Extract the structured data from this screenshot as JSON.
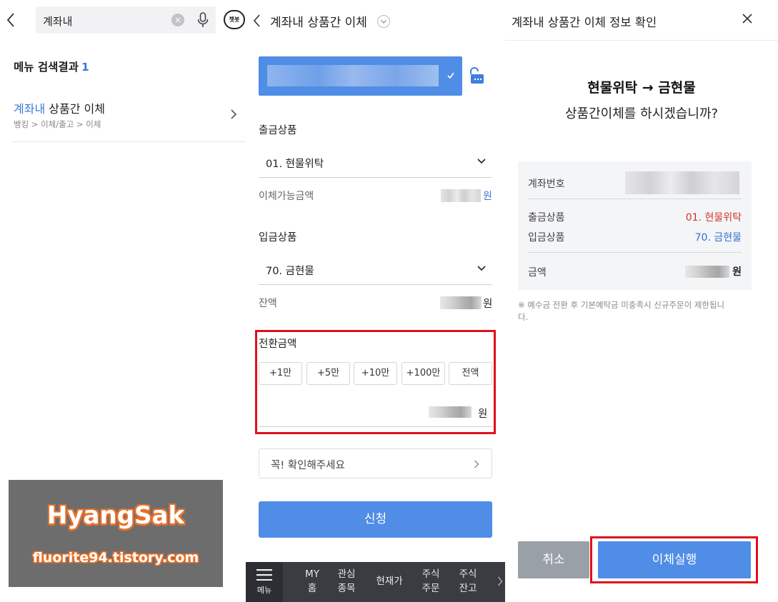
{
  "search_panel": {
    "query": "계좌내",
    "results_label": "메뉴 검색결과",
    "results_count": "1",
    "result": {
      "name_highlight": "계좌내",
      "name_rest": " 상품간 이체",
      "path": "뱅킹 > 이체/출고 > 이체"
    },
    "chatbot_label": "챗봇",
    "watermark": {
      "title": "HyangSak",
      "url": "fluorite94.tistory.com"
    }
  },
  "transfer_panel": {
    "title": "계좌내 상품간 이체",
    "out_product_label": "출금상품",
    "out_product_value": "01. 현물위탁",
    "available_label": "이체가능금액",
    "currency_unit": "원",
    "in_product_label": "입금상품",
    "in_product_value": "70. 금현물",
    "balance_label": "잔액",
    "amount_label": "전환금액",
    "amount_buttons": [
      "+1만",
      "+5만",
      "+10만",
      "+100만",
      "전액"
    ],
    "confirm_notice": "꼭! 확인해주세요",
    "submit_label": "신청",
    "nav": {
      "menu": "메뉴",
      "items": [
        {
          "line1": "MY",
          "line2": "홈"
        },
        {
          "line1": "관심",
          "line2": "종목"
        },
        {
          "line1": "현재가",
          "line2": ""
        },
        {
          "line1": "주식",
          "line2": "주문"
        },
        {
          "line1": "주식",
          "line2": "잔고"
        }
      ]
    }
  },
  "confirm_panel": {
    "title": "계좌내 상품간 이체 정보 확인",
    "headline": "현물위탁 → 금현물",
    "question": "상품간이체를 하시겠습니까?",
    "account_label": "계좌번호",
    "out_label": "출금상품",
    "out_value": "01. 현물위탁",
    "in_label": "입금상품",
    "in_value": "70. 금현물",
    "amount_label": "금액",
    "amount_unit": "원",
    "notice": "※ 예수금 전환 후 기본예탁금 미충족시 신규주문이 제한됩니다.",
    "cancel_label": "취소",
    "execute_label": "이체실행",
    "colors": {
      "out_value": "#d6322d",
      "in_value": "#2f6fd0",
      "highlight_box": "#e0101a",
      "primary": "#4f8de6"
    }
  }
}
